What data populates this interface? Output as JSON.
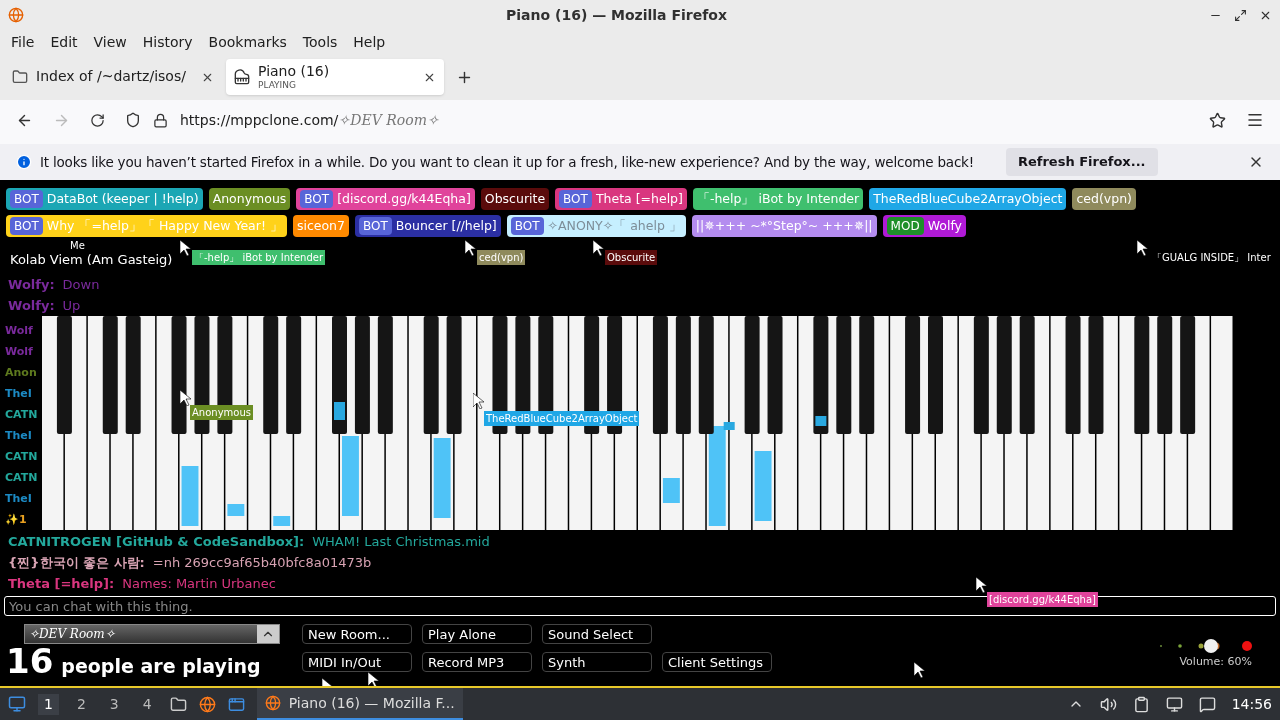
{
  "window": {
    "title": "Piano (16) — Mozilla Firefox"
  },
  "menu": [
    "File",
    "Edit",
    "View",
    "History",
    "Bookmarks",
    "Tools",
    "Help"
  ],
  "tabs": [
    {
      "title": "Index of /~dartz/isos/",
      "selected": false
    },
    {
      "title": "Piano (16)",
      "subtitle": "PLAYING",
      "selected": true
    }
  ],
  "address": {
    "host": "https://mppclone.com/",
    "path": "✧DEV Room✧"
  },
  "notification": {
    "text": "It looks like you haven’t started Firefox in a while. Do you want to clean it up for a fresh, like-new experience? And by the way, welcome back!",
    "button": "Refresh Firefox..."
  },
  "name_tags": [
    {
      "badge": "BOT",
      "name": "DataBot (keeper | !help)",
      "color": "#1ba6b4"
    },
    {
      "name": "Anonymous",
      "color": "#6b8e23"
    },
    {
      "badge": "BOT",
      "name": "[discord.gg/k44Eqha]",
      "color": "#e0439b"
    },
    {
      "name": "Obscurite",
      "color": "#5a0b0b"
    },
    {
      "badge": "BOT",
      "name": "Theta [=help]",
      "color": "#d9367f"
    },
    {
      "name": "「-help」 iBot by Intender",
      "color": "#3fbf6e"
    },
    {
      "name": "TheRedBlueCube2ArrayObject",
      "color": "#1fa7e6"
    },
    {
      "name": "ced(vpn)",
      "color": "#8f8a5c"
    },
    {
      "badge": "BOT",
      "name": "Why 「=help」「 Happy New Year! 」",
      "color": "#ffd21a"
    },
    {
      "name": "siceon7",
      "color": "#ff8a00"
    },
    {
      "badge": "BOT",
      "name": "Bouncer [//help]",
      "color": "#2b2fa3"
    },
    {
      "badge": "BOT",
      "name": "✧ANONY✧「 ahelp 」",
      "color": "#c6efff"
    },
    {
      "name": "||✵+++ ~*°Step°~ +++✵||",
      "color": "#b48cef"
    },
    {
      "badge": "MOD",
      "name": "Wolfy",
      "color": "#b01ad6"
    }
  ],
  "own_cursor": {
    "tag": "Me",
    "name": "Kolab Viem (Am Gasteig)"
  },
  "chat_top": [
    {
      "name": "Wolfy:",
      "text": "Down",
      "color": "#7a2a9c"
    },
    {
      "name": "Wolfy:",
      "text": "Up",
      "color": "#7a2a9c"
    }
  ],
  "chat_cut": [
    {
      "text": "Wolf",
      "color": "#7a2a9c"
    },
    {
      "text": "Wolf",
      "color": "#7a2a9c"
    },
    {
      "text": "Anon",
      "color": "#5e7a1e"
    },
    {
      "text": "TheI",
      "color": "#1c8ac4"
    },
    {
      "text": "CATN",
      "color": "#23a89c"
    },
    {
      "text": "TheI",
      "color": "#1c8ac4"
    },
    {
      "text": "CATN",
      "color": "#23a89c"
    },
    {
      "text": "CATN",
      "color": "#23a89c"
    },
    {
      "text": "TheI",
      "color": "#1c8ac4"
    },
    {
      "text": "✨1",
      "color": "#e8a020"
    }
  ],
  "chat_bottom": [
    {
      "name": "CATNITROGEN [GitHub & CodeSandbox]:",
      "text": "WHAM! Last Christmas.mid",
      "color": "#23a89c"
    },
    {
      "name": "{찐}한국이 좋은 사람:",
      "text": "=nh 269cc9af65b40bfc8a01473b",
      "color": "#d8a3b3"
    },
    {
      "name": "Theta [=help]:",
      "text": "Names: Martin Urbanec",
      "color": "#d9367f"
    }
  ],
  "cursors": [
    {
      "name": "Anonymous",
      "color": "#6b8e23"
    },
    {
      "name": "TheRedBlueCube2ArrayObject",
      "color": "#1fa7e6"
    },
    {
      "name": "[discord.gg/k44Eqha]",
      "color": "#e0439b"
    },
    {
      "name": "「-help」 iBot by Intender",
      "color": "#3fbf6e"
    },
    {
      "name": "ced(vpn)",
      "color": "#8f8a5c"
    },
    {
      "name": "Obscurite",
      "color": "#5a0b0b"
    },
    {
      "name": "「GUALG INSIDE」 Inter",
      "color": "#000000"
    }
  ],
  "chat_input": {
    "placeholder": "You can chat with this thing."
  },
  "room": {
    "name": "✧DEV Room✧"
  },
  "players": {
    "count": "16",
    "label": "people are playing"
  },
  "buttons": [
    [
      "New Room...",
      "Play Alone",
      "Sound Select"
    ],
    [
      "MIDI In/Out",
      "Record MP3",
      "Synth",
      "Client Settings"
    ]
  ],
  "volume": {
    "label": "Volume: 60%"
  },
  "taskbar": {
    "workspaces": [
      {
        "label": "1",
        "selected": true
      },
      {
        "label": "2",
        "selected": false
      },
      {
        "label": "3",
        "selected": false
      },
      {
        "label": "4",
        "selected": false
      }
    ],
    "task": "Piano (16) — Mozilla F...",
    "clock": "14:56"
  }
}
